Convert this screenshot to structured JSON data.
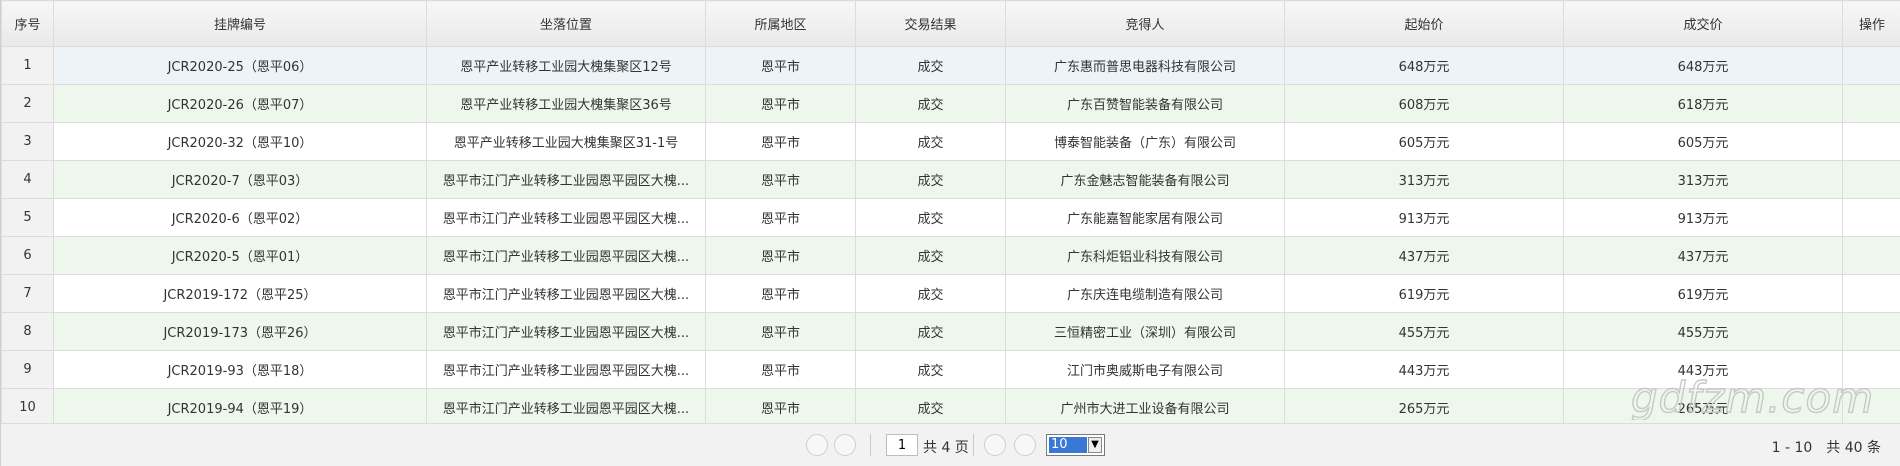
{
  "table": {
    "headers": [
      "序号",
      "挂牌编号",
      "坐落位置",
      "所属地区",
      "交易结果",
      "竞得人",
      "起始价",
      "成交价",
      "操作"
    ],
    "rows": [
      {
        "idx": "1",
        "code": "JCR2020-25（恩平06）",
        "location": "恩平产业转移工业园大槐集聚区12号",
        "region": "恩平市",
        "result": "成交",
        "winner": "广东惠而普思电器科技有限公司",
        "start": "648万元",
        "deal": "648万元",
        "op": ""
      },
      {
        "idx": "2",
        "code": "JCR2020-26（恩平07）",
        "location": "恩平产业转移工业园大槐集聚区36号",
        "region": "恩平市",
        "result": "成交",
        "winner": "广东百赞智能装备有限公司",
        "start": "608万元",
        "deal": "618万元",
        "op": ""
      },
      {
        "idx": "3",
        "code": "JCR2020-32（恩平10）",
        "location": "恩平产业转移工业园大槐集聚区31-1号",
        "region": "恩平市",
        "result": "成交",
        "winner": "博泰智能装备（广东）有限公司",
        "start": "605万元",
        "deal": "605万元",
        "op": ""
      },
      {
        "idx": "4",
        "code": "JCR2020-7（恩平03）",
        "location": "恩平市江门产业转移工业园恩平园区大槐...",
        "region": "恩平市",
        "result": "成交",
        "winner": "广东金魅志智能装备有限公司",
        "start": "313万元",
        "deal": "313万元",
        "op": ""
      },
      {
        "idx": "5",
        "code": "JCR2020-6（恩平02）",
        "location": "恩平市江门产业转移工业园恩平园区大槐...",
        "region": "恩平市",
        "result": "成交",
        "winner": "广东能嘉智能家居有限公司",
        "start": "913万元",
        "deal": "913万元",
        "op": ""
      },
      {
        "idx": "6",
        "code": "JCR2020-5（恩平01）",
        "location": "恩平市江门产业转移工业园恩平园区大槐...",
        "region": "恩平市",
        "result": "成交",
        "winner": "广东科炬铝业科技有限公司",
        "start": "437万元",
        "deal": "437万元",
        "op": ""
      },
      {
        "idx": "7",
        "code": "JCR2019-172（恩平25）",
        "location": "恩平市江门产业转移工业园恩平园区大槐...",
        "region": "恩平市",
        "result": "成交",
        "winner": "广东庆连电缆制造有限公司",
        "start": "619万元",
        "deal": "619万元",
        "op": ""
      },
      {
        "idx": "8",
        "code": "JCR2019-173（恩平26）",
        "location": "恩平市江门产业转移工业园恩平园区大槐...",
        "region": "恩平市",
        "result": "成交",
        "winner": "三恒精密工业（深圳）有限公司",
        "start": "455万元",
        "deal": "455万元",
        "op": ""
      },
      {
        "idx": "9",
        "code": "JCR2019-93（恩平18）",
        "location": "恩平市江门产业转移工业园恩平园区大槐...",
        "region": "恩平市",
        "result": "成交",
        "winner": "江门市奥威斯电子有限公司",
        "start": "443万元",
        "deal": "443万元",
        "op": ""
      },
      {
        "idx": "10",
        "code": "JCR2019-94（恩平19）",
        "location": "恩平市江门产业转移工业园恩平园区大槐...",
        "region": "恩平市",
        "result": "成交",
        "winner": "广州市大进工业设备有限公司",
        "start": "265万元",
        "deal": "265万元",
        "op": ""
      }
    ]
  },
  "pager": {
    "current_page": "1",
    "total_pages": "共 4 页",
    "page_size": "10",
    "range_text": "1 - 10　共 40 条"
  },
  "watermark": "gdfzm.com",
  "icons": {
    "first": "first-page-icon",
    "prev": "prev-page-icon",
    "next": "next-page-icon",
    "last": "last-page-icon"
  }
}
